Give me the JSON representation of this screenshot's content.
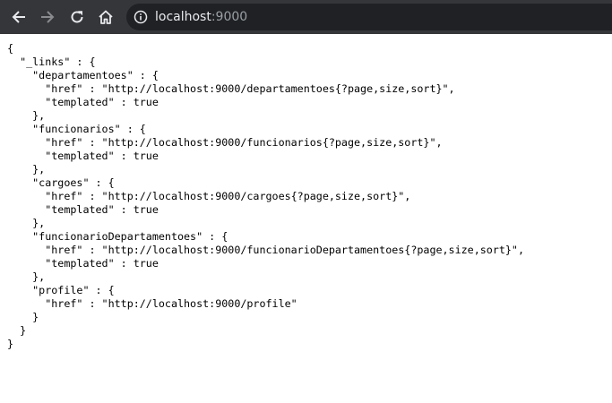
{
  "browser": {
    "url_host": "localhost",
    "url_port": ":9000",
    "icons": {
      "back": "arrow-left-icon",
      "forward": "arrow-right-icon",
      "reload": "reload-icon",
      "home": "home-icon",
      "info": "info-icon"
    },
    "colors": {
      "toolbar": "#35363a",
      "omnibox": "#202124"
    }
  },
  "json_body": "{\n  \"_links\" : {\n    \"departamentoes\" : {\n      \"href\" : \"http://localhost:9000/departamentoes{?page,size,sort}\",\n      \"templated\" : true\n    },\n    \"funcionarios\" : {\n      \"href\" : \"http://localhost:9000/funcionarios{?page,size,sort}\",\n      \"templated\" : true\n    },\n    \"cargoes\" : {\n      \"href\" : \"http://localhost:9000/cargoes{?page,size,sort}\",\n      \"templated\" : true\n    },\n    \"funcionarioDepartamentoes\" : {\n      \"href\" : \"http://localhost:9000/funcionarioDepartamentoes{?page,size,sort}\",\n      \"templated\" : true\n    },\n    \"profile\" : {\n      \"href\" : \"http://localhost:9000/profile\"\n    }\n  }\n}"
}
